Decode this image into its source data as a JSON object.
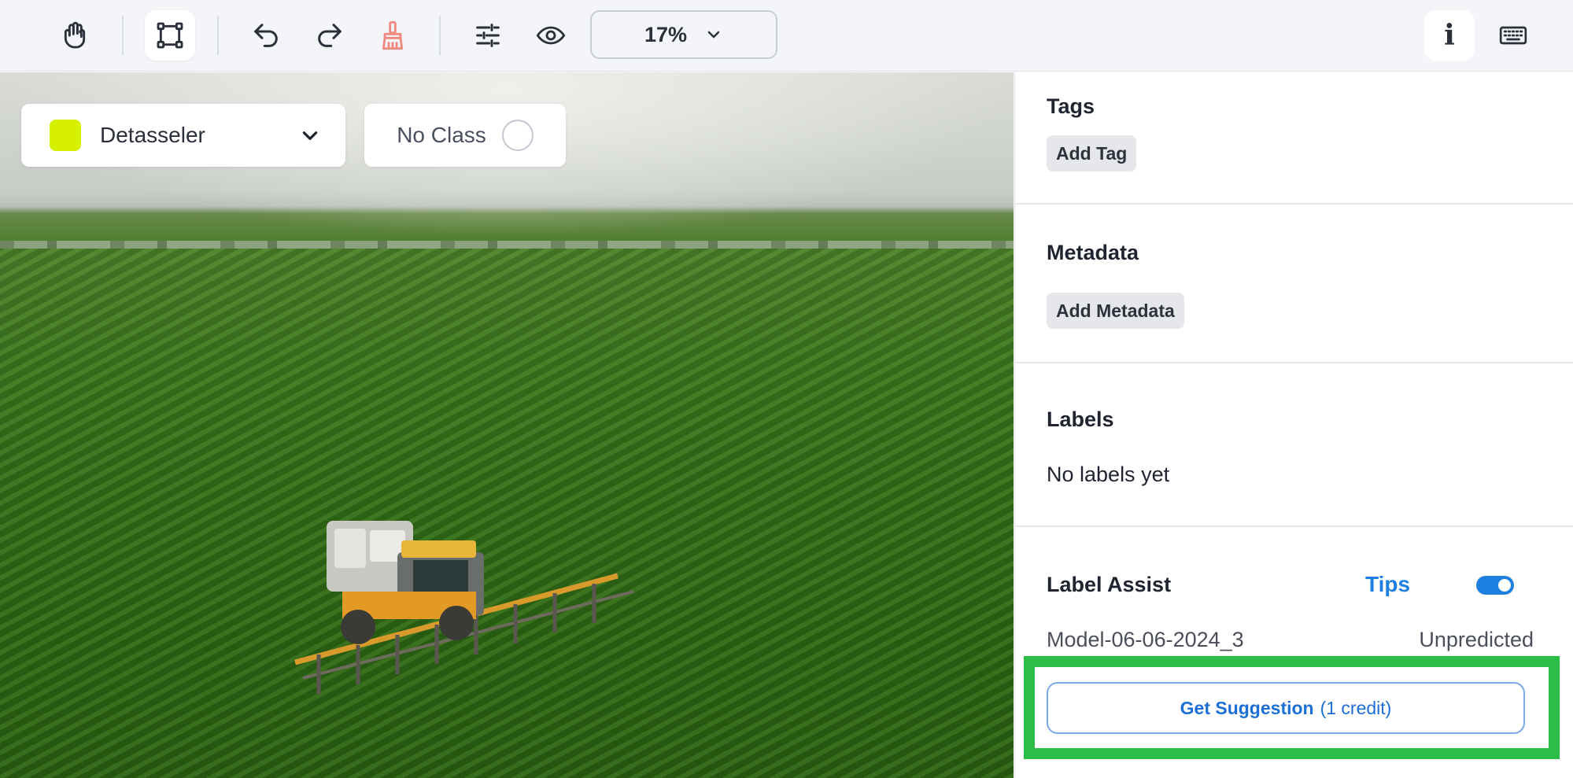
{
  "toolbar": {
    "tools": [
      {
        "icon": "hand-icon"
      },
      {
        "icon": "bounding-box-icon",
        "active": true
      },
      {
        "icon": "undo-icon"
      },
      {
        "icon": "redo-icon"
      },
      {
        "icon": "brush-icon"
      },
      {
        "icon": "sliders-icon"
      },
      {
        "icon": "eye-icon"
      }
    ],
    "zoom_value": "17%",
    "info_label": "i",
    "keyboard_icon": "keyboard-icon"
  },
  "canvas": {
    "class_select": {
      "label": "Detasseler",
      "color": "#d7f000"
    },
    "no_class": {
      "label": "No Class"
    }
  },
  "panel": {
    "tags": {
      "title": "Tags",
      "add_label": "Add Tag"
    },
    "metadata": {
      "title": "Metadata",
      "add_label": "Add Metadata"
    },
    "labels": {
      "title": "Labels",
      "empty_text": "No labels yet"
    },
    "label_assist": {
      "title": "Label Assist",
      "tips_label": "Tips",
      "enabled": true,
      "model_name": "Model-06-06-2024_3",
      "model_status": "Unpredicted",
      "button_label": "Get Suggestion",
      "button_credit": "(1 credit)"
    }
  },
  "colors": {
    "accent": "#1d7fe0",
    "highlight": "#2bbd45",
    "brush": "#f08a80"
  }
}
